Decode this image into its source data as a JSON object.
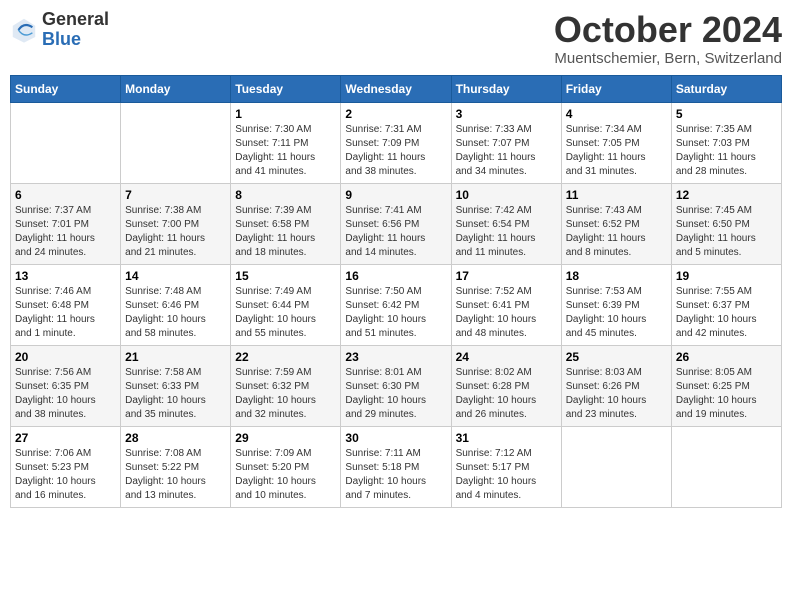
{
  "header": {
    "logo_general": "General",
    "logo_blue": "Blue",
    "month_title": "October 2024",
    "location": "Muentschemier, Bern, Switzerland"
  },
  "weekdays": [
    "Sunday",
    "Monday",
    "Tuesday",
    "Wednesday",
    "Thursday",
    "Friday",
    "Saturday"
  ],
  "weeks": [
    [
      {
        "day": "",
        "info": ""
      },
      {
        "day": "",
        "info": ""
      },
      {
        "day": "1",
        "info": "Sunrise: 7:30 AM\nSunset: 7:11 PM\nDaylight: 11 hours\nand 41 minutes."
      },
      {
        "day": "2",
        "info": "Sunrise: 7:31 AM\nSunset: 7:09 PM\nDaylight: 11 hours\nand 38 minutes."
      },
      {
        "day": "3",
        "info": "Sunrise: 7:33 AM\nSunset: 7:07 PM\nDaylight: 11 hours\nand 34 minutes."
      },
      {
        "day": "4",
        "info": "Sunrise: 7:34 AM\nSunset: 7:05 PM\nDaylight: 11 hours\nand 31 minutes."
      },
      {
        "day": "5",
        "info": "Sunrise: 7:35 AM\nSunset: 7:03 PM\nDaylight: 11 hours\nand 28 minutes."
      }
    ],
    [
      {
        "day": "6",
        "info": "Sunrise: 7:37 AM\nSunset: 7:01 PM\nDaylight: 11 hours\nand 24 minutes."
      },
      {
        "day": "7",
        "info": "Sunrise: 7:38 AM\nSunset: 7:00 PM\nDaylight: 11 hours\nand 21 minutes."
      },
      {
        "day": "8",
        "info": "Sunrise: 7:39 AM\nSunset: 6:58 PM\nDaylight: 11 hours\nand 18 minutes."
      },
      {
        "day": "9",
        "info": "Sunrise: 7:41 AM\nSunset: 6:56 PM\nDaylight: 11 hours\nand 14 minutes."
      },
      {
        "day": "10",
        "info": "Sunrise: 7:42 AM\nSunset: 6:54 PM\nDaylight: 11 hours\nand 11 minutes."
      },
      {
        "day": "11",
        "info": "Sunrise: 7:43 AM\nSunset: 6:52 PM\nDaylight: 11 hours\nand 8 minutes."
      },
      {
        "day": "12",
        "info": "Sunrise: 7:45 AM\nSunset: 6:50 PM\nDaylight: 11 hours\nand 5 minutes."
      }
    ],
    [
      {
        "day": "13",
        "info": "Sunrise: 7:46 AM\nSunset: 6:48 PM\nDaylight: 11 hours\nand 1 minute."
      },
      {
        "day": "14",
        "info": "Sunrise: 7:48 AM\nSunset: 6:46 PM\nDaylight: 10 hours\nand 58 minutes."
      },
      {
        "day": "15",
        "info": "Sunrise: 7:49 AM\nSunset: 6:44 PM\nDaylight: 10 hours\nand 55 minutes."
      },
      {
        "day": "16",
        "info": "Sunrise: 7:50 AM\nSunset: 6:42 PM\nDaylight: 10 hours\nand 51 minutes."
      },
      {
        "day": "17",
        "info": "Sunrise: 7:52 AM\nSunset: 6:41 PM\nDaylight: 10 hours\nand 48 minutes."
      },
      {
        "day": "18",
        "info": "Sunrise: 7:53 AM\nSunset: 6:39 PM\nDaylight: 10 hours\nand 45 minutes."
      },
      {
        "day": "19",
        "info": "Sunrise: 7:55 AM\nSunset: 6:37 PM\nDaylight: 10 hours\nand 42 minutes."
      }
    ],
    [
      {
        "day": "20",
        "info": "Sunrise: 7:56 AM\nSunset: 6:35 PM\nDaylight: 10 hours\nand 38 minutes."
      },
      {
        "day": "21",
        "info": "Sunrise: 7:58 AM\nSunset: 6:33 PM\nDaylight: 10 hours\nand 35 minutes."
      },
      {
        "day": "22",
        "info": "Sunrise: 7:59 AM\nSunset: 6:32 PM\nDaylight: 10 hours\nand 32 minutes."
      },
      {
        "day": "23",
        "info": "Sunrise: 8:01 AM\nSunset: 6:30 PM\nDaylight: 10 hours\nand 29 minutes."
      },
      {
        "day": "24",
        "info": "Sunrise: 8:02 AM\nSunset: 6:28 PM\nDaylight: 10 hours\nand 26 minutes."
      },
      {
        "day": "25",
        "info": "Sunrise: 8:03 AM\nSunset: 6:26 PM\nDaylight: 10 hours\nand 23 minutes."
      },
      {
        "day": "26",
        "info": "Sunrise: 8:05 AM\nSunset: 6:25 PM\nDaylight: 10 hours\nand 19 minutes."
      }
    ],
    [
      {
        "day": "27",
        "info": "Sunrise: 7:06 AM\nSunset: 5:23 PM\nDaylight: 10 hours\nand 16 minutes."
      },
      {
        "day": "28",
        "info": "Sunrise: 7:08 AM\nSunset: 5:22 PM\nDaylight: 10 hours\nand 13 minutes."
      },
      {
        "day": "29",
        "info": "Sunrise: 7:09 AM\nSunset: 5:20 PM\nDaylight: 10 hours\nand 10 minutes."
      },
      {
        "day": "30",
        "info": "Sunrise: 7:11 AM\nSunset: 5:18 PM\nDaylight: 10 hours\nand 7 minutes."
      },
      {
        "day": "31",
        "info": "Sunrise: 7:12 AM\nSunset: 5:17 PM\nDaylight: 10 hours\nand 4 minutes."
      },
      {
        "day": "",
        "info": ""
      },
      {
        "day": "",
        "info": ""
      }
    ]
  ]
}
